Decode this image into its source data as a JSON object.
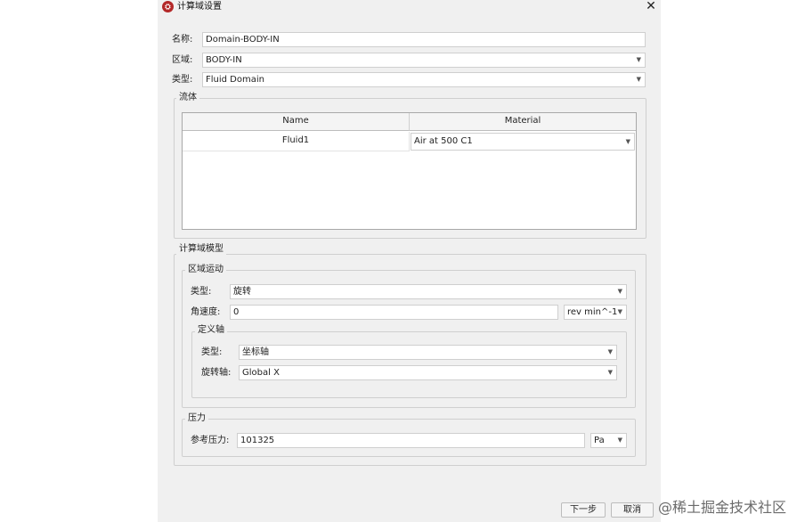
{
  "window": {
    "title": "计算域设置",
    "app_icon_glyph": "⛭"
  },
  "general": {
    "name_label": "名称:",
    "name_value": "Domain-BODY-IN",
    "region_label": "区域:",
    "region_value": "BODY-IN",
    "type_label": "类型:",
    "type_value": "Fluid Domain"
  },
  "fluid": {
    "legend": "流体",
    "columns": [
      "Name",
      "Material"
    ],
    "rows": [
      {
        "name": "Fluid1",
        "material": "Air at 500 C1"
      }
    ]
  },
  "domain_model": {
    "legend": "计算域模型",
    "motion": {
      "legend": "区域运动",
      "type_label": "类型:",
      "type_value": "旋转",
      "angular_label": "角速度:",
      "angular_value": "0",
      "angular_unit": "rev min^-1",
      "axis": {
        "legend": "定义轴",
        "type_label": "类型:",
        "type_value": "坐标轴",
        "rot_label": "旋转轴:",
        "rot_value": "Global X"
      }
    },
    "pressure": {
      "legend": "压力",
      "ref_label": "参考压力:",
      "ref_value": "101325",
      "unit": "Pa"
    }
  },
  "buttons": {
    "next": "下一步",
    "cancel": "取消"
  },
  "watermark": "@稀土掘金技术社区"
}
